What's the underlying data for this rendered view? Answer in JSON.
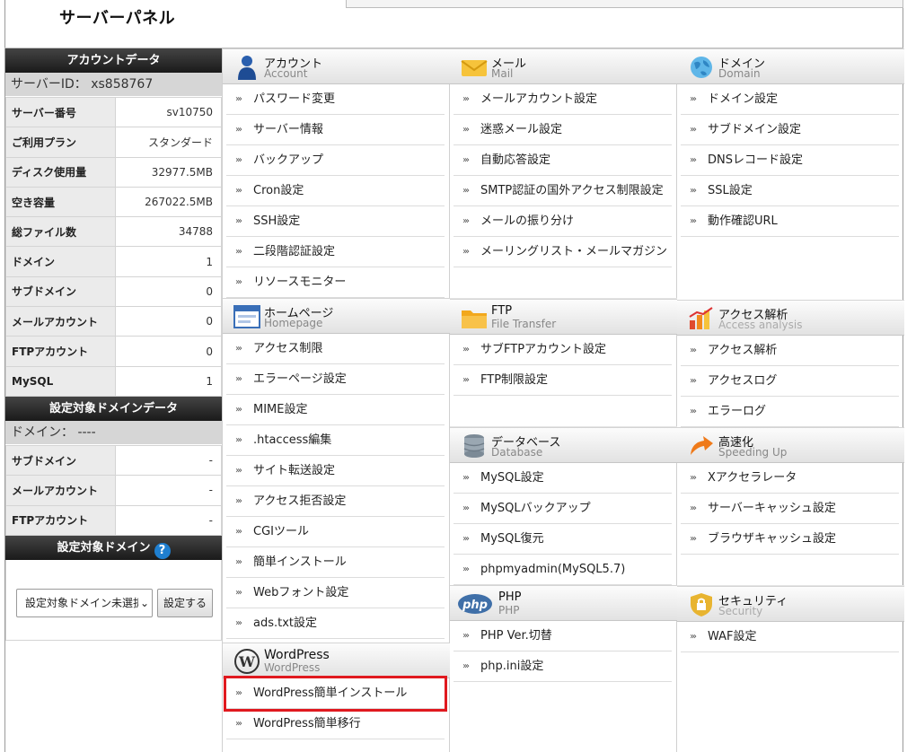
{
  "panel": {
    "title": "サーバーパネル"
  },
  "account_data": {
    "header": "アカウントデータ",
    "server_id": "サーバーID： xs858767",
    "rows": [
      {
        "label": "サーバー番号",
        "value": "sv10750"
      },
      {
        "label": "ご利用プラン",
        "value": "スタンダード"
      },
      {
        "label": "ディスク使用量",
        "value": "32977.5MB"
      },
      {
        "label": "空き容量",
        "value": "267022.5MB"
      },
      {
        "label": "総ファイル数",
        "value": "34788"
      },
      {
        "label": "ドメイン",
        "value": "1"
      },
      {
        "label": "サブドメイン",
        "value": "0"
      },
      {
        "label": "メールアカウント",
        "value": "0"
      },
      {
        "label": "FTPアカウント",
        "value": "0"
      },
      {
        "label": "MySQL",
        "value": "1"
      }
    ]
  },
  "target_domain_data": {
    "header": "設定対象ドメインデータ",
    "domain": "ドメイン： ----",
    "rows": [
      {
        "label": "サブドメイン",
        "value": "-"
      },
      {
        "label": "メールアカウント",
        "value": "-"
      },
      {
        "label": "FTPアカウント",
        "value": "-"
      }
    ]
  },
  "target_domain": {
    "header": "設定対象ドメイン",
    "help_icon": "?",
    "select_value": "設定対象ドメイン未選択",
    "caret": "⌄",
    "button": "設定する"
  },
  "sections": {
    "account": {
      "jp": "アカウント",
      "en": "Account",
      "items": [
        "パスワード変更",
        "サーバー情報",
        "バックアップ",
        "Cron設定",
        "SSH設定",
        "二段階認証設定",
        "リソースモニター"
      ]
    },
    "homepage": {
      "jp": "ホームページ",
      "en": "Homepage",
      "items": [
        "アクセス制限",
        "エラーページ設定",
        "MIME設定",
        ".htaccess編集",
        "サイト転送設定",
        "アクセス拒否設定",
        "CGIツール",
        "簡単インストール",
        "Webフォント設定",
        "ads.txt設定"
      ]
    },
    "wordpress": {
      "jp": "WordPress",
      "en": "WordPress",
      "items": [
        "WordPress簡単インストール",
        "WordPress簡単移行"
      ]
    },
    "mail": {
      "jp": "メール",
      "en": "Mail",
      "items": [
        "メールアカウント設定",
        "迷惑メール設定",
        "自動応答設定",
        "SMTP認証の国外アクセス制限設定",
        "メールの振り分け",
        "メーリングリスト・メールマガジン"
      ]
    },
    "ftp": {
      "jp": "FTP",
      "en": "File Transfer",
      "items": [
        "サブFTPアカウント設定",
        "FTP制限設定"
      ]
    },
    "database": {
      "jp": "データベース",
      "en": "Database",
      "items": [
        "MySQL設定",
        "MySQLバックアップ",
        "MySQL復元",
        "phpmyadmin(MySQL5.7)"
      ]
    },
    "php": {
      "jp": "PHP",
      "en": "PHP",
      "icon_text": "php",
      "items": [
        "PHP Ver.切替",
        "php.ini設定"
      ]
    },
    "domain": {
      "jp": "ドメイン",
      "en": "Domain",
      "items": [
        "ドメイン設定",
        "サブドメイン設定",
        "DNSレコード設定",
        "SSL設定",
        "動作確認URL"
      ]
    },
    "access": {
      "jp": "アクセス解析",
      "en": "Access analysis",
      "items": [
        "アクセス解析",
        "アクセスログ",
        "エラーログ"
      ]
    },
    "speed": {
      "jp": "高速化",
      "en": "Speeding Up",
      "items": [
        "Xアクセラレータ",
        "サーバーキャッシュ設定",
        "ブラウザキャッシュ設定"
      ]
    },
    "security": {
      "jp": "セキュリティ",
      "en": "Security",
      "items": [
        "WAF設定"
      ]
    }
  },
  "highlight_item": "WordPress簡単インストール",
  "colors": {
    "highlight": "#e0191f",
    "help_icon": "#1f7fd0",
    "dark_header": "#222222"
  }
}
